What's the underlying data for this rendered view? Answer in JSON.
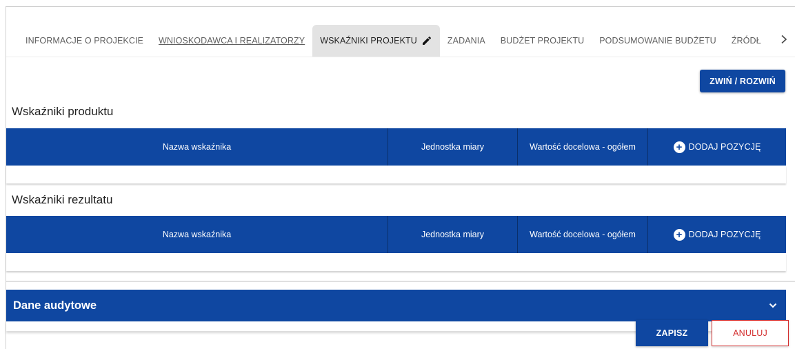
{
  "tabs": [
    {
      "label": "INFORMACJE O PROJEKCIE",
      "active": false
    },
    {
      "label": "WNIOSKODAWCA I REALIZATORZY",
      "active": false
    },
    {
      "label": "WSKAŹNIKI PROJEKTU",
      "active": true
    },
    {
      "label": "ZADANIA",
      "active": false
    },
    {
      "label": "BUDŻET PROJEKTU",
      "active": false
    },
    {
      "label": "PODSUMOWANIE BUDŻETU",
      "active": false
    },
    {
      "label": "ŹRÓDŁA",
      "active": false
    }
  ],
  "icons": {
    "active_tab": "pencil-icon",
    "scroll": "chevron-right-icon",
    "add": "plus-circle-icon",
    "accordion": "chevron-down-icon"
  },
  "toolbar": {
    "collapse_label": "ZWIŃ / ROZWIŃ"
  },
  "sections": {
    "product": {
      "title": "Wskaźniki produktu",
      "columns": {
        "name": "Nazwa wskaźnika",
        "unit": "Jednostka miary",
        "value": "Wartość docelowa - ogółem",
        "add": "DODAJ POZYCJĘ"
      }
    },
    "result": {
      "title": "Wskaźniki rezultatu",
      "columns": {
        "name": "Nazwa wskaźnika",
        "unit": "Jednostka miary",
        "value": "Wartość docelowa - ogółem",
        "add": "DODAJ POZYCJĘ"
      }
    }
  },
  "audit": {
    "title": "Dane audytowe"
  },
  "footer": {
    "save_label": "ZAPISZ",
    "cancel_label": "ANULUJ"
  },
  "colors": {
    "primary": "#0f47a1",
    "danger": "#d32f2f",
    "active_tab": "#e3e3e3"
  }
}
